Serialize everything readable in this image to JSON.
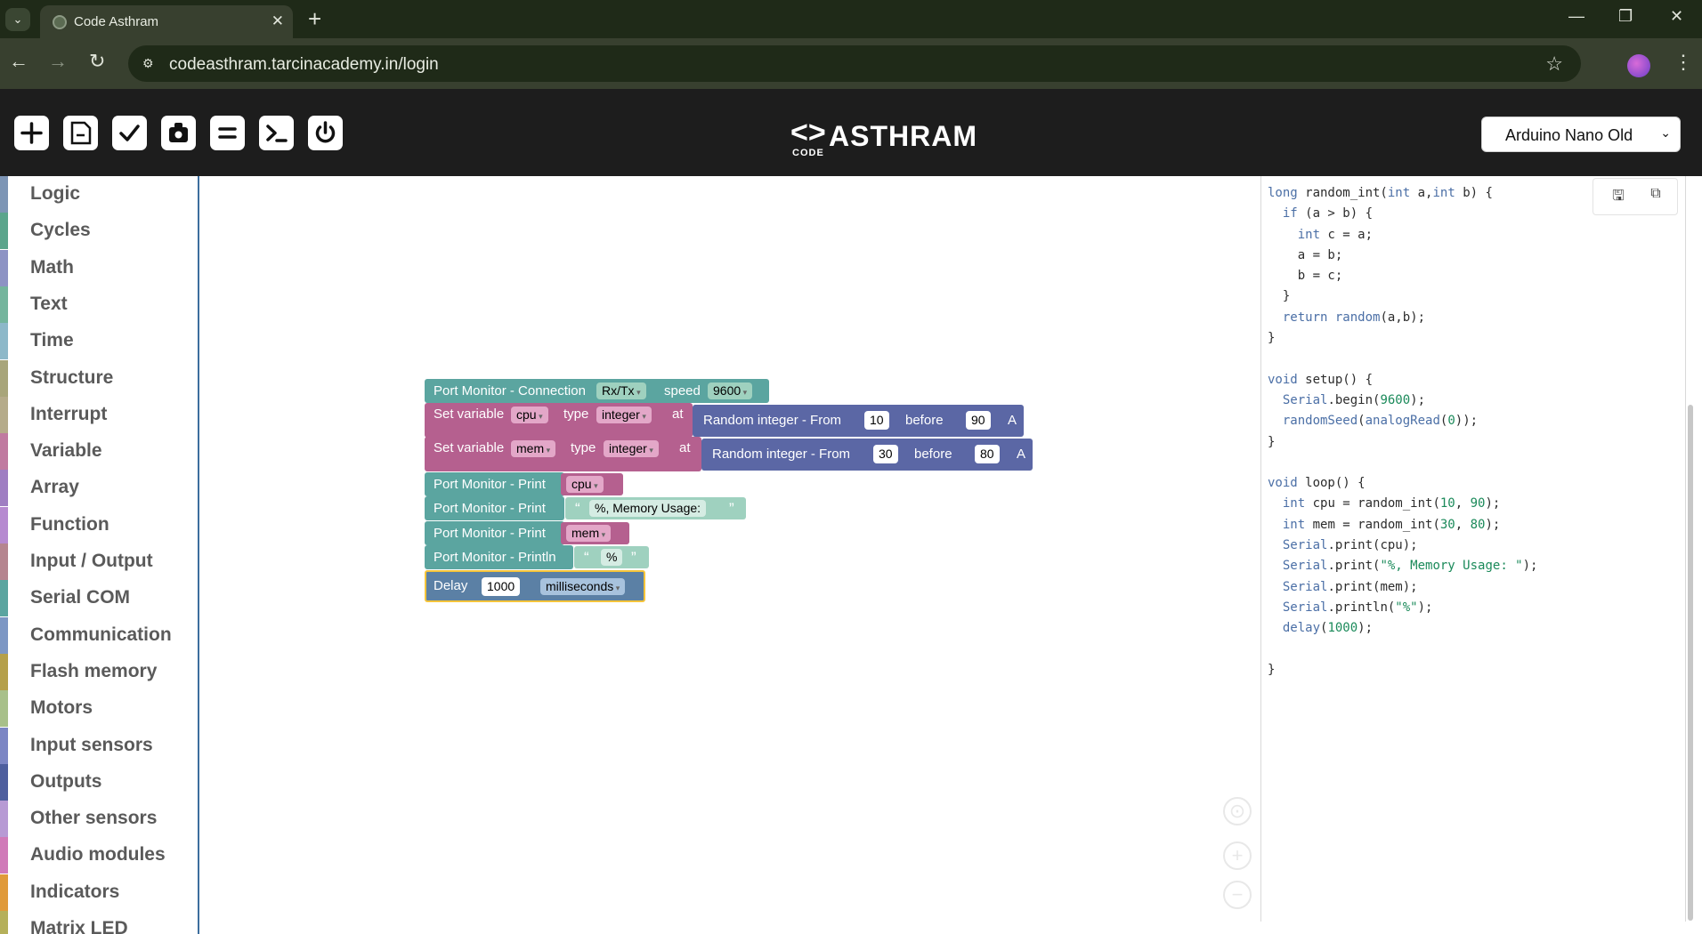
{
  "browser": {
    "tab_title": "Code Asthram",
    "url": "codeasthram.tarcinacademy.in/login"
  },
  "header": {
    "logo_mark": "<>",
    "logo_text": "ASTHRAM",
    "logo_sub": "CODE",
    "board": "Arduino Nano Old"
  },
  "toolbox": {
    "categories": [
      {
        "label": "Logic",
        "color": "#7d95b5"
      },
      {
        "label": "Cycles",
        "color": "#5ba58c"
      },
      {
        "label": "Math",
        "color": "#8d93c4"
      },
      {
        "label": "Text",
        "color": "#74b59d"
      },
      {
        "label": "Time",
        "color": "#8db8c9"
      },
      {
        "label": "Structure",
        "color": "#a8a57a"
      },
      {
        "label": "Interrupt",
        "color": "#b5ab8a"
      },
      {
        "label": "Variable",
        "color": "#c07aa0"
      },
      {
        "label": "Array",
        "color": "#9f7ec2"
      },
      {
        "label": "Function",
        "color": "#b68ad0"
      },
      {
        "label": "Input / Output",
        "color": "#b5858f"
      },
      {
        "label": "Serial COM",
        "color": "#5ba5a0"
      },
      {
        "label": "Communication",
        "color": "#7d97c4"
      },
      {
        "label": "Flash memory",
        "color": "#b5a04a"
      },
      {
        "label": "Motors",
        "color": "#a8c08a"
      },
      {
        "label": "Input sensors",
        "color": "#7c86c4"
      },
      {
        "label": "Outputs",
        "color": "#4e5f9e"
      },
      {
        "label": "Other sensors",
        "color": "#b79ad4"
      },
      {
        "label": "Audio modules",
        "color": "#d07ab8"
      },
      {
        "label": "Indicators",
        "color": "#e09a3a"
      },
      {
        "label": "Matrix LED",
        "color": "#b5b05a"
      }
    ]
  },
  "blocks": {
    "b1": {
      "text1": "Port Monitor - Connection",
      "field1": "Rx/Tx",
      "text2": "speed",
      "field2": "9600"
    },
    "b2": {
      "text1": "Set variable",
      "field1": "cpu",
      "text2": "type",
      "field2": "integer",
      "text3": "at",
      "rand_text": "Random integer - From",
      "from": "10",
      "before_text": "before",
      "to": "90",
      "suffix": "A"
    },
    "b3": {
      "text1": "Set variable",
      "field1": "mem",
      "text2": "type",
      "field2": "integer",
      "text3": "at",
      "rand_text": "Random integer - From",
      "from": "30",
      "before_text": "before",
      "to": "80",
      "suffix": "A"
    },
    "b4": {
      "text1": "Port Monitor - Print",
      "field1": "cpu"
    },
    "b5": {
      "text1": "Port Monitor - Print",
      "open_quote": "“",
      "str": "%, Memory Usage:",
      "close_quote": "”"
    },
    "b6": {
      "text1": "Port Monitor - Print",
      "field1": "mem"
    },
    "b7": {
      "text1": "Port Monitor - Println",
      "open_quote": "“",
      "str": "%",
      "close_quote": "”"
    },
    "b8": {
      "text1": "Delay",
      "value": "1000",
      "unit": "milliseconds"
    }
  },
  "code": {
    "lines": [
      "long random_int(int a,int b) {",
      "  if (a > b) {",
      "    int c = a;",
      "    a = b;",
      "    b = c;",
      "  }",
      "  return random(a,b);",
      "}",
      "",
      "void setup() {",
      "  Serial.begin(9600);",
      "  randomSeed(analogRead(0));",
      "}",
      "",
      "void loop() {",
      "  int cpu = random_int(10, 90);",
      "  int mem = random_int(30, 80);",
      "  Serial.print(cpu);",
      "  Serial.print(\"%, Memory Usage: \");",
      "  Serial.print(mem);",
      "  Serial.println(\"%\");",
      "  delay(1000);",
      "",
      "}"
    ]
  },
  "colors": {
    "serial_block": "#5ba5a0",
    "variable_block": "#b5608f",
    "math_block": "#5b67a5",
    "delay_block": "#5b80a5",
    "string_block": "#9fd1bf"
  }
}
